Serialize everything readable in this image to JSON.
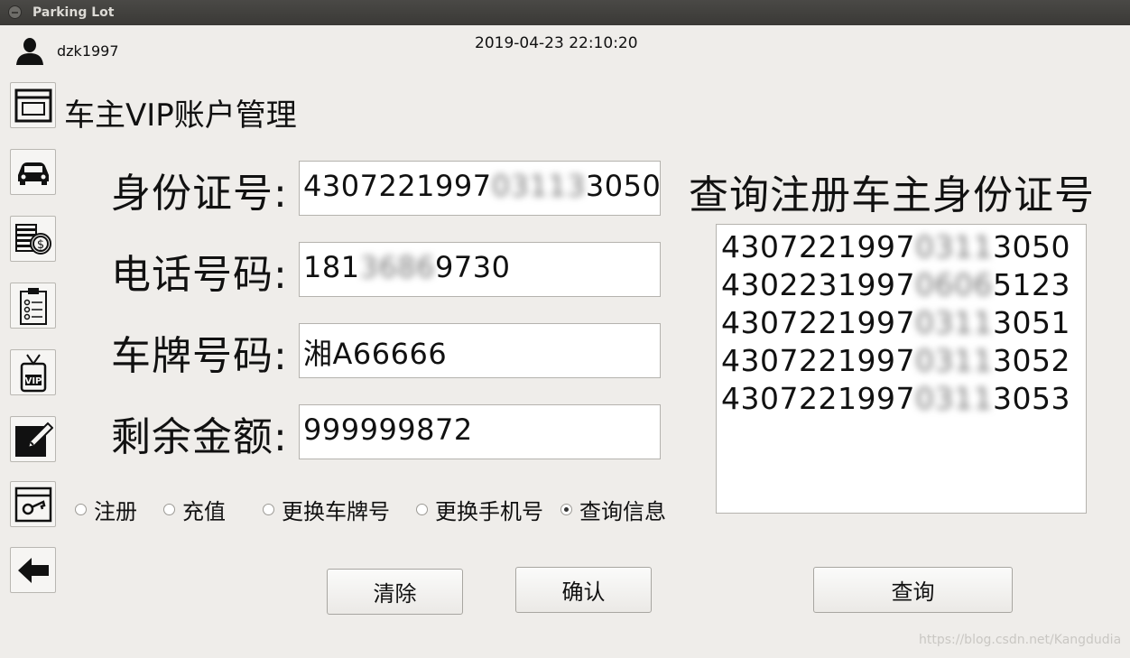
{
  "window": {
    "title": "Parking Lot"
  },
  "header": {
    "username": "dzk1997",
    "datetime": "2019-04-23 22:10:20"
  },
  "sidebar": {
    "items": [
      {
        "icon": "window-icon"
      },
      {
        "icon": "car-icon"
      },
      {
        "icon": "coins-icon"
      },
      {
        "icon": "clipboard-icon"
      },
      {
        "icon": "vip-badge-icon"
      },
      {
        "icon": "edit-icon"
      },
      {
        "icon": "key-window-icon"
      },
      {
        "icon": "back-arrow-icon"
      }
    ]
  },
  "page": {
    "title": "车主VIP账户管理"
  },
  "form": {
    "id_label": "身份证号:",
    "id_value_prefix": "4307221997",
    "id_value_masked": "03113",
    "id_value_suffix": "3050",
    "phone_label": "电话号码:",
    "phone_value_prefix": "181",
    "phone_value_masked": "3686",
    "phone_value_suffix": "9730",
    "plate_label": "车牌号码:",
    "plate_value": "湘A66666",
    "balance_label": "剩余金额:",
    "balance_value": "999999872"
  },
  "query": {
    "title": "查询注册车主身份证号",
    "results": [
      {
        "prefix": "4307221997",
        "masked": "0311",
        "suffix": "3050"
      },
      {
        "prefix": "4302231997",
        "masked": "0606",
        "suffix": "5123"
      },
      {
        "prefix": "4307221997",
        "masked": "0311",
        "suffix": "3051"
      },
      {
        "prefix": "4307221997",
        "masked": "0311",
        "suffix": "3052"
      },
      {
        "prefix": "4307221997",
        "masked": "0311",
        "suffix": "3053"
      }
    ]
  },
  "modes": {
    "register": "注册",
    "recharge": "充值",
    "change_plate": "更换车牌号",
    "change_phone": "更换手机号",
    "query_info": "查询信息",
    "selected": "query_info"
  },
  "buttons": {
    "clear": "清除",
    "confirm": "确认",
    "query": "查询"
  },
  "watermark": "https://blog.csdn.net/Kangdudia"
}
